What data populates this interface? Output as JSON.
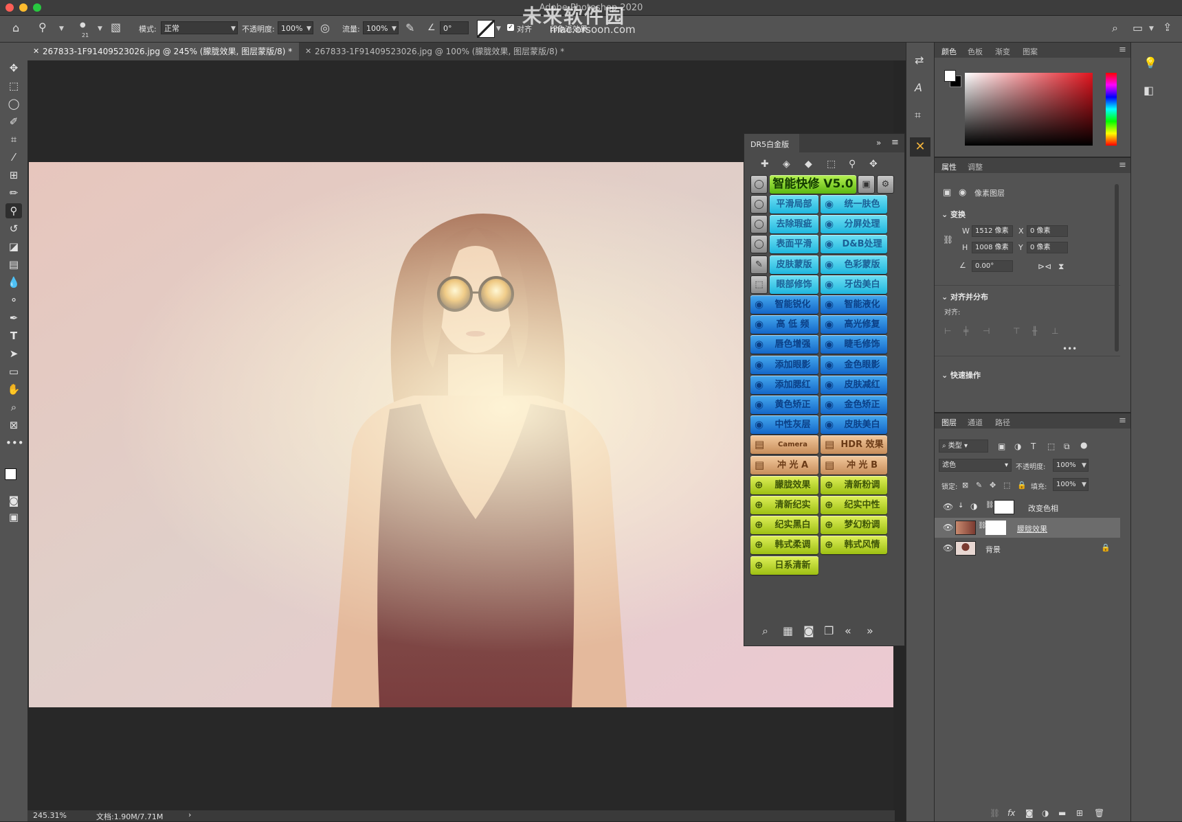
{
  "window": {
    "title": "Adobe Photoshop 2020"
  },
  "watermark": {
    "brand": "未来软件园",
    "url": "mac.orsoon.com"
  },
  "options_bar": {
    "brush_size": "21",
    "mode_label": "模式:",
    "mode_value": "正常",
    "opacity_label": "不透明度:",
    "opacity_value": "100%",
    "flow_label": "流量:",
    "flow_value": "100%",
    "angle_value": "0°",
    "align_label": "对齐",
    "sample_label": "印象派效果"
  },
  "tabs": [
    {
      "label": "267833-1F91409523026.jpg @ 245% (朦胧效果, 图层蒙版/8) *",
      "active": true
    },
    {
      "label": "267833-1F91409523026.jpg @ 100% (朦胧效果, 图层蒙版/8) *",
      "active": false
    }
  ],
  "status": {
    "zoom": "245.31%",
    "doc": "文档:1.90M/7.71M",
    "arrow": "›"
  },
  "dr5": {
    "title": "DR5白金版",
    "headline": "智能快修 V5.0",
    "rows": [
      {
        "left": "平滑局部",
        "right": "统一肤色",
        "style": "cyan"
      },
      {
        "left": "去除瑕疵",
        "right": "分屏处理",
        "style": "cyan"
      },
      {
        "left": "表面平滑",
        "right": "D&B处理",
        "style": "cyan"
      },
      {
        "left": "皮肤蒙版",
        "right": "色彩蒙版",
        "style": "cyan"
      },
      {
        "left": "眼部修饰",
        "right": "牙齿美白",
        "style": "cyan"
      },
      {
        "left": "智能锐化",
        "right": "智能液化",
        "style": "blue"
      },
      {
        "left": "高 低 频",
        "right": "高光修复",
        "style": "blue"
      },
      {
        "left": "唇色增强",
        "right": "睫毛修饰",
        "style": "blue"
      },
      {
        "left": "添加眼影",
        "right": "金色眼影",
        "style": "blue"
      },
      {
        "left": "添加腮红",
        "right": "皮肤减红",
        "style": "blue"
      },
      {
        "left": "黄色矫正",
        "right": "金色矫正",
        "style": "blue"
      },
      {
        "left": "中性灰层",
        "right": "皮肤美白",
        "style": "blue"
      },
      {
        "left": "Camera Raw",
        "right": "HDR 效果",
        "style": "tan"
      },
      {
        "left": "冲 光 A",
        "right": "冲 光 B",
        "style": "tan"
      },
      {
        "left": "朦胧效果",
        "right": "清新粉调",
        "style": "lime"
      },
      {
        "left": "清新纪实",
        "right": "纪实中性",
        "style": "lime"
      },
      {
        "left": "纪实黑白",
        "right": "梦幻粉调",
        "style": "lime"
      },
      {
        "left": "韩式柔调",
        "right": "韩式风情",
        "style": "lime"
      }
    ],
    "last": "日系清新"
  },
  "color_panel": {
    "tabs": [
      "颜色",
      "色板",
      "渐变",
      "图案"
    ]
  },
  "properties": {
    "tabs": [
      "属性",
      "调整"
    ],
    "kind": "像素图层",
    "transform_label": "变换",
    "w_label": "W",
    "w": "1512 像素",
    "h_label": "H",
    "h": "1008 像素",
    "x_label": "X",
    "x": "0 像素",
    "y_label": "Y",
    "y": "0 像素",
    "angle": "0.00°",
    "align_label": "对齐并分布",
    "align_sub": "对齐:",
    "quick_label": "快速操作"
  },
  "layers": {
    "tabs": [
      "图层",
      "通道",
      "路径"
    ],
    "filter": "类型",
    "blend": "滤色",
    "opacity_label": "不透明度:",
    "opacity": "100%",
    "lock_label": "锁定:",
    "fill_label": "填充:",
    "fill": "100%",
    "items": [
      {
        "name": "改变色相"
      },
      {
        "name": "朦胧效果"
      },
      {
        "name": "背景"
      }
    ]
  },
  "colors": {
    "fg": "#ffffff",
    "bg": "#000000",
    "ui_dark": "#262626",
    "ui_panel": "#535353"
  }
}
